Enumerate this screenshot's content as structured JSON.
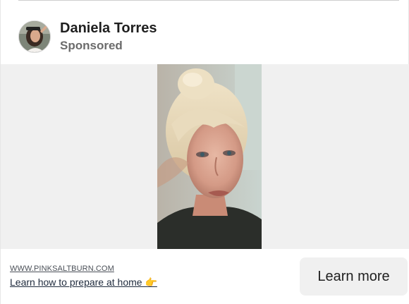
{
  "post": {
    "author_name": "Daniela Torres",
    "label": "Sponsored"
  },
  "ad": {
    "display_url": "WWW.PINKSALTBURN.COM",
    "headline": "Learn how to prepare at home 👉",
    "cta_label": "Learn more"
  },
  "colors": {
    "media_background": "#f0f0f0",
    "cta_background": "#f0f0f0",
    "text_primary": "#1f1f1f",
    "text_secondary": "#6b6b6b"
  }
}
